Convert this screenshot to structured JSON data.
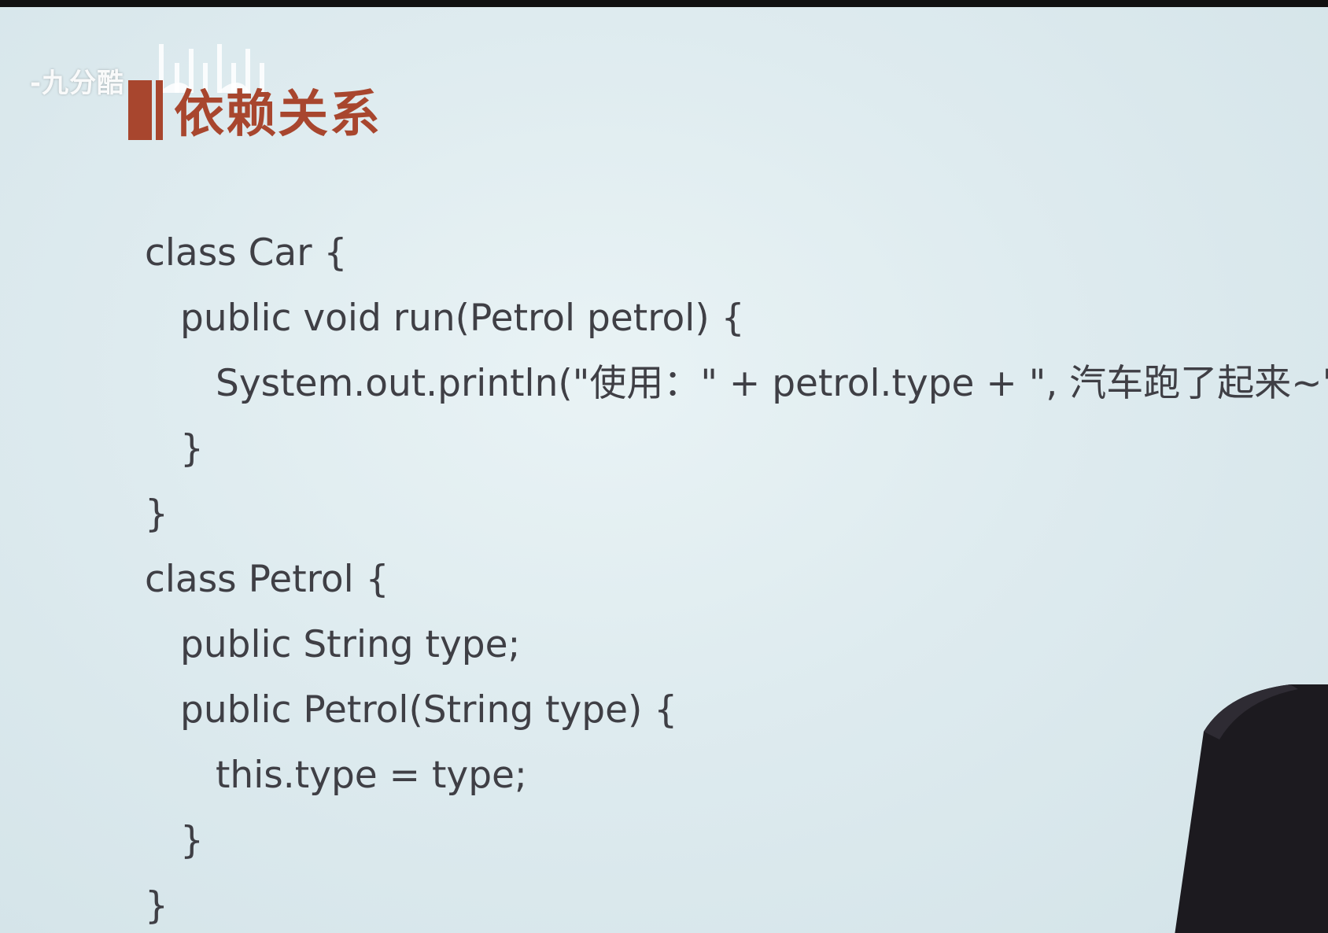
{
  "watermark": {
    "text": "-九分酷"
  },
  "slide": {
    "title": "依赖关系",
    "code_lines": [
      {
        "indent": 0,
        "text": "class Car {"
      },
      {
        "indent": 1,
        "text": "public void run(Petrol petrol) {"
      },
      {
        "indent": 2,
        "text": "System.out.println(\"使用：\" + petrol.type + \", 汽车跑了起来~\");"
      },
      {
        "indent": 1,
        "text": "}"
      },
      {
        "indent": 0,
        "text": "}"
      },
      {
        "indent": 0,
        "text": "class Petrol {"
      },
      {
        "indent": 1,
        "text": "public String type;"
      },
      {
        "indent": 1,
        "text": "public Petrol(String type) {"
      },
      {
        "indent": 2,
        "text": "this.type = type;"
      },
      {
        "indent": 1,
        "text": "}"
      },
      {
        "indent": 0,
        "text": "}"
      }
    ]
  },
  "colors": {
    "title_accent": "#a8462e",
    "code_text": "#3f3f45",
    "background": "#dbe8ec"
  },
  "icons": {
    "title_marker": "title-bar-icon",
    "logo": "bilibili-logo-icon"
  }
}
